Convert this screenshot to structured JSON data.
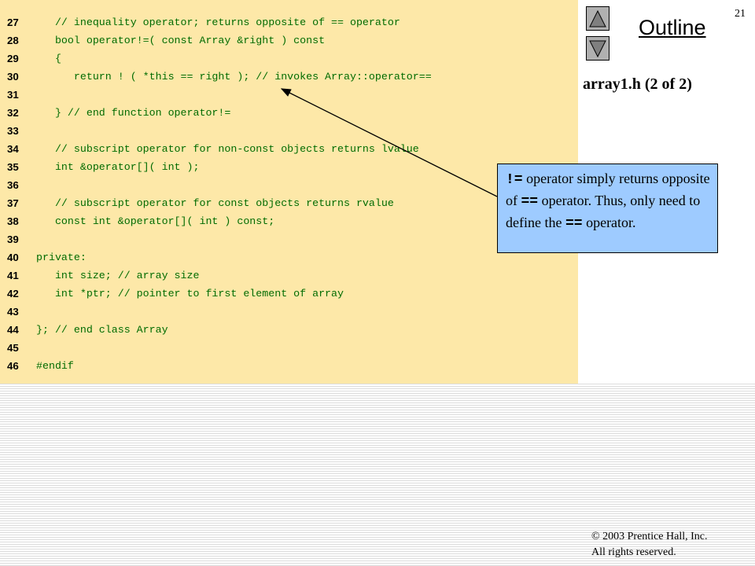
{
  "slide": {
    "page_number": "21",
    "outline_label": "Outline",
    "file_title": "array1.h (2 of 2)",
    "nav_icons": [
      "triangle-up-icon",
      "triangle-down-icon"
    ]
  },
  "code_lines": [
    {
      "num": "27",
      "text": "   // inequality operator; returns opposite of == operator"
    },
    {
      "num": "28",
      "text": "   bool operator!=( const Array &right ) const"
    },
    {
      "num": "29",
      "text": "   {"
    },
    {
      "num": "30",
      "text": "      return ! ( *this == right ); // invokes Array::operator=="
    },
    {
      "num": "31",
      "text": ""
    },
    {
      "num": "32",
      "text": "   } // end function operator!="
    },
    {
      "num": "33",
      "text": ""
    },
    {
      "num": "34",
      "text": "   // subscript operator for non-const objects returns lvalue"
    },
    {
      "num": "35",
      "text": "   int &operator[]( int );"
    },
    {
      "num": "36",
      "text": ""
    },
    {
      "num": "37",
      "text": "   // subscript operator for const objects returns rvalue"
    },
    {
      "num": "38",
      "text": "   const int &operator[]( int ) const;"
    },
    {
      "num": "39",
      "text": ""
    },
    {
      "num": "40",
      "text": "private:"
    },
    {
      "num": "41",
      "text": "   int size; // array size"
    },
    {
      "num": "42",
      "text": "   int *ptr; // pointer to first element of array"
    },
    {
      "num": "43",
      "text": ""
    },
    {
      "num": "44",
      "text": "}; // end class Array"
    },
    {
      "num": "45",
      "text": ""
    },
    {
      "num": "46",
      "text": "#endif"
    }
  ],
  "callout": {
    "op1": "!=",
    "t1": " operator simply returns opposite of ",
    "op2": "==",
    "t2": " operator. Thus, only need to define the ",
    "op3": "==",
    "t3": " operator."
  },
  "footer": {
    "copyright_symbol": "©",
    "line1": " 2003 Prentice Hall, Inc.",
    "line2": "All rights reserved."
  },
  "colors": {
    "code_background": "#fde8a8",
    "code_text": "#006b00",
    "callout_background": "#9ecbff",
    "nav_button": "#b0b0b0"
  }
}
